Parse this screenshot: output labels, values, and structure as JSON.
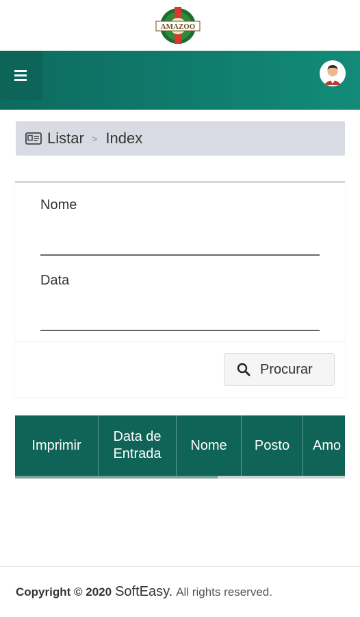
{
  "logo": {
    "text": "AMAZOO"
  },
  "header": {
    "menu_icon": "hamburger-icon",
    "avatar_icon": "user-avatar-icon"
  },
  "breadcrumb": {
    "icon": "id-card-icon",
    "items": [
      "Listar",
      "Index"
    ],
    "separator": ">"
  },
  "search_form": {
    "fields": [
      {
        "label": "Nome",
        "value": ""
      },
      {
        "label": "Data",
        "value": ""
      }
    ],
    "button_label": "Procurar",
    "button_icon": "search-icon"
  },
  "table": {
    "columns": [
      "Imprimir",
      "Data de\nEntrada",
      "Nome",
      "Posto",
      "Amo"
    ]
  },
  "footer": {
    "copyright": "Copyright © 2020",
    "brand": "SoftEasy.",
    "rights": "All rights reserved."
  },
  "colors": {
    "primary": "#0f6457",
    "topbar": "#128b78",
    "breadcrumb_bg": "#d8dbe3"
  }
}
